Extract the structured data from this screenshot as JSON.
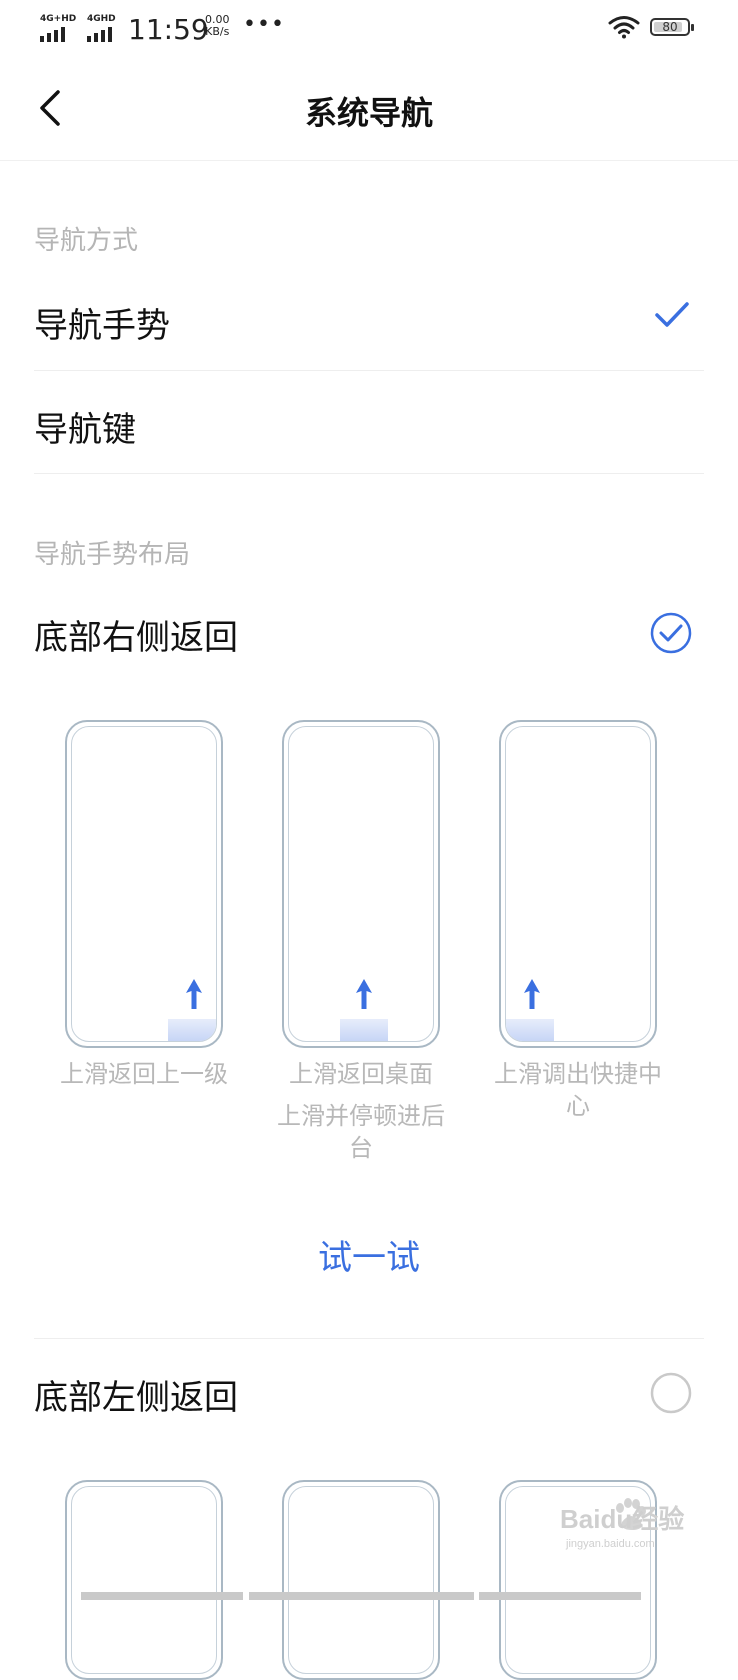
{
  "status_bar": {
    "sim1": "4G+HD",
    "sim2": "4GHD",
    "time": "11:59",
    "speed_value": "0.00",
    "speed_unit": "KB/s",
    "battery": "80"
  },
  "header": {
    "title": "系统导航"
  },
  "nav_mode": {
    "section_label": "导航方式",
    "options": [
      {
        "label": "导航手势",
        "selected": true
      },
      {
        "label": "导航键",
        "selected": false
      }
    ]
  },
  "gesture_layout": {
    "section_label": "导航手势布局",
    "option1": {
      "label": "底部右侧返回",
      "selected": true,
      "captions": [
        "上滑返回上一级",
        "上滑返回桌面",
        "上滑并停顿进后台",
        "上滑调出快捷中心"
      ]
    },
    "try_label": "试一试",
    "option2": {
      "label": "底部左侧返回",
      "selected": false
    }
  },
  "watermark": {
    "text": "Baidu经验",
    "url": "jingyan.baidu.com"
  },
  "colors": {
    "accent": "#3a6fe0",
    "muted": "#b5b5b5",
    "phone_outline": "#a9b8c4"
  }
}
